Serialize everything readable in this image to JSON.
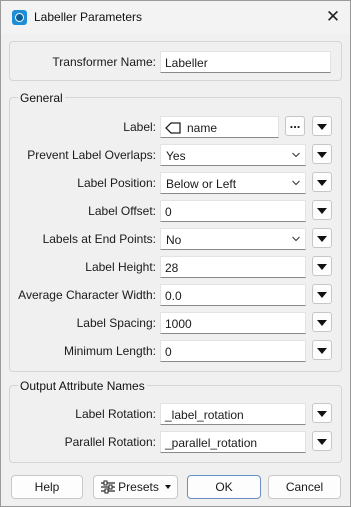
{
  "window": {
    "title": "Labeller Parameters",
    "close_glyph": "✕"
  },
  "transformer": {
    "label": "Transformer Name:",
    "value": "Labeller"
  },
  "general": {
    "title": "General",
    "label": {
      "label": "Label:",
      "value": "name",
      "browse": "..."
    },
    "prevent_overlaps": {
      "label": "Prevent Label Overlaps:",
      "value": "Yes"
    },
    "position": {
      "label": "Label Position:",
      "value": "Below or Left"
    },
    "offset": {
      "label": "Label Offset:",
      "value": "0"
    },
    "end_points": {
      "label": "Labels at End Points:",
      "value": "No"
    },
    "height": {
      "label": "Label Height:",
      "value": "28"
    },
    "char_width": {
      "label": "Average Character Width:",
      "value": "0.0"
    },
    "spacing": {
      "label": "Label Spacing:",
      "value": "1000"
    },
    "min_length": {
      "label": "Minimum Length:",
      "value": "0"
    }
  },
  "output": {
    "title": "Output Attribute Names",
    "rotation": {
      "label": "Label Rotation:",
      "value": "_label_rotation"
    },
    "parallel": {
      "label": "Parallel Rotation:",
      "value": "_parallel_rotation"
    }
  },
  "buttons": {
    "help": "Help",
    "presets": "Presets",
    "ok": "OK",
    "cancel": "Cancel"
  },
  "colors": {
    "accent": "#1e8fd6",
    "ok_border": "#6a8fbf"
  }
}
